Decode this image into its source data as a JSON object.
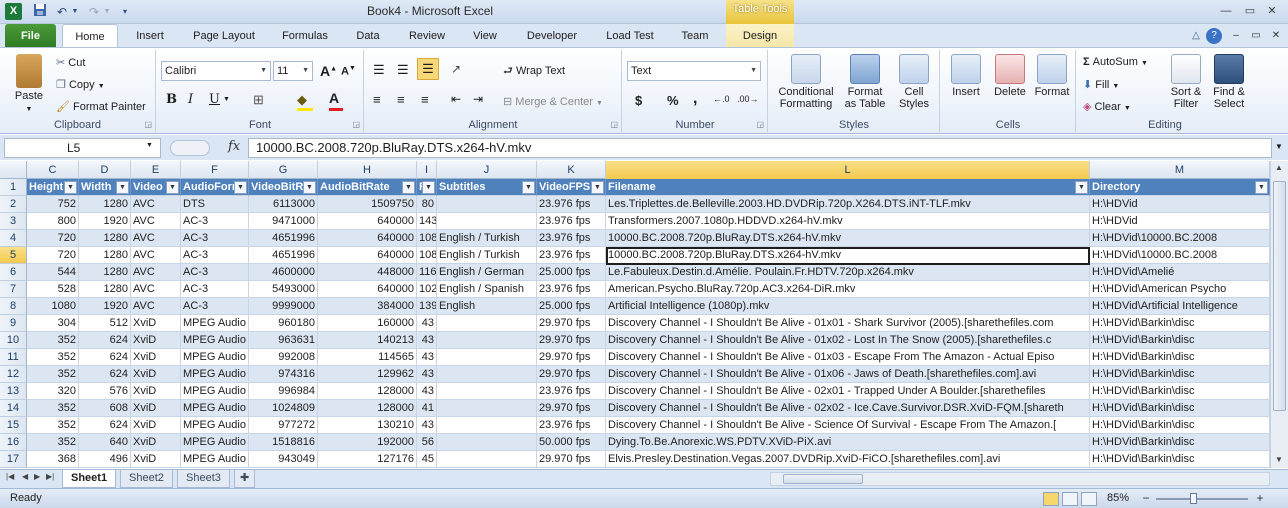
{
  "window": {
    "title": "Book4  -  Microsoft Excel",
    "contextual_tab": "Table Tools",
    "logo": "X",
    "qat_icons": [
      "save-icon",
      "undo-icon",
      "redo-icon",
      "customize-qat-icon"
    ],
    "controls": [
      "minimize-icon",
      "maximize-icon",
      "close-icon"
    ]
  },
  "tabs": [
    "File",
    "Home",
    "Insert",
    "Page Layout",
    "Formulas",
    "Data",
    "Review",
    "View",
    "Developer",
    "Load Test",
    "Team",
    "Design"
  ],
  "active_tab": "Home",
  "ribbon": {
    "clipboard": {
      "label": "Clipboard",
      "paste": "Paste",
      "cut": "Cut",
      "copy": "Copy",
      "format_painter": "Format Painter"
    },
    "font": {
      "label": "Font",
      "font_name": "Calibri",
      "font_size": "11",
      "bold": "B",
      "italic": "I",
      "underline": "U",
      "grow": "A",
      "shrink": "A"
    },
    "alignment": {
      "label": "Alignment",
      "wrap_text": "Wrap Text",
      "merge_center": "Merge & Center"
    },
    "number": {
      "label": "Number",
      "format": "Text",
      "currency": "$",
      "percent": "%",
      "comma": ","
    },
    "styles": {
      "label": "Styles",
      "conditional": [
        "Conditional",
        "Formatting"
      ],
      "format_table": [
        "Format",
        "as Table"
      ],
      "cell_styles": [
        "Cell",
        "Styles"
      ]
    },
    "cells": {
      "label": "Cells",
      "insert": "Insert",
      "delete": "Delete",
      "format": "Format"
    },
    "editing": {
      "label": "Editing",
      "autosum": "AutoSum",
      "fill": "Fill",
      "clear": "Clear",
      "sort_filter": [
        "Sort &",
        "Filter"
      ],
      "find_select": [
        "Find &",
        "Select"
      ]
    }
  },
  "formula_bar": {
    "name_box": "L5",
    "fx": "fx",
    "value": "10000.BC.2008.720p.BluRay.DTS.x264-hV.mkv"
  },
  "columns": [
    "C",
    "D",
    "E",
    "F",
    "G",
    "H",
    "I",
    "J",
    "K",
    "L",
    "M"
  ],
  "selected_column": "L",
  "header_row": {
    "row": "1",
    "cells": [
      "Height",
      "Width",
      "Video",
      "AudioForm",
      "VideoBitR",
      "AudioBitRate",
      "Ru",
      "Subtitles",
      "VideoFPS",
      "Filename",
      "Directory"
    ]
  },
  "rows": [
    {
      "row": "2",
      "cells": [
        "752",
        "1280",
        "AVC",
        "DTS",
        "6113000",
        "1509750",
        "80",
        "",
        "23.976 fps",
        "Les.Triplettes.de.Belleville.2003.HD.DVDRip.720p.X264.DTS.iNT-TLF.mkv",
        "H:\\HDVid"
      ]
    },
    {
      "row": "3",
      "cells": [
        "800",
        "1920",
        "AVC",
        "AC-3",
        "9471000",
        "640000",
        "143",
        "",
        "23.976 fps",
        "Transformers.2007.1080p.HDDVD.x264-hV.mkv",
        "H:\\HDVid"
      ]
    },
    {
      "row": "4",
      "cells": [
        "720",
        "1280",
        "AVC",
        "AC-3",
        "4651996",
        "640000",
        "108",
        "English / Turkish",
        "23.976 fps",
        "10000.BC.2008.720p.BluRay.DTS.x264-hV.mkv",
        "H:\\HDVid\\10000.BC.2008"
      ]
    },
    {
      "row": "5",
      "cells": [
        "720",
        "1280",
        "AVC",
        "AC-3",
        "4651996",
        "640000",
        "108",
        "English / Turkish",
        "23.976 fps",
        "10000.BC.2008.720p.BluRay.DTS.x264-hV.mkv",
        "H:\\HDVid\\10000.BC.2008"
      ]
    },
    {
      "row": "6",
      "cells": [
        "544",
        "1280",
        "AVC",
        "AC-3",
        "4600000",
        "448000",
        "116",
        "English / German",
        "25.000 fps",
        "Le.Fabuleux.Destin.d.Amélie. Poulain.Fr.HDTV.720p.x264.mkv",
        "H:\\HDVid\\Amelié"
      ]
    },
    {
      "row": "7",
      "cells": [
        "528",
        "1280",
        "AVC",
        "AC-3",
        "5493000",
        "640000",
        "102",
        "English / Spanish",
        "23.976 fps",
        "American.Psycho.BluRay.720p.AC3.x264-DiR.mkv",
        "H:\\HDVid\\American Psycho"
      ]
    },
    {
      "row": "8",
      "cells": [
        "1080",
        "1920",
        "AVC",
        "AC-3",
        "9999000",
        "384000",
        "139",
        "English",
        "25.000 fps",
        "Artificial Intelligence (1080p).mkv",
        "H:\\HDVid\\Artificial Intelligence"
      ]
    },
    {
      "row": "9",
      "cells": [
        "304",
        "512",
        "XviD",
        "MPEG Audio",
        "960180",
        "160000",
        "43",
        "",
        "29.970 fps",
        "Discovery Channel - I Shouldn't Be Alive - 01x01 - Shark Survivor (2005).[sharethefiles.com",
        "H:\\HDVid\\Barkin\\disc"
      ]
    },
    {
      "row": "10",
      "cells": [
        "352",
        "624",
        "XviD",
        "MPEG Audio",
        "963631",
        "140213",
        "43",
        "",
        "29.970 fps",
        "Discovery Channel - I Shouldn't Be Alive - 01x02 - Lost In The Snow (2005).[sharethefiles.c",
        "H:\\HDVid\\Barkin\\disc"
      ]
    },
    {
      "row": "11",
      "cells": [
        "352",
        "624",
        "XviD",
        "MPEG Audio",
        "992008",
        "114565",
        "43",
        "",
        "29.970 fps",
        "Discovery Channel - I Shouldn't Be Alive - 01x03 - Escape From The Amazon - Actual Episo",
        "H:\\HDVid\\Barkin\\disc"
      ]
    },
    {
      "row": "12",
      "cells": [
        "352",
        "624",
        "XviD",
        "MPEG Audio",
        "974316",
        "129962",
        "43",
        "",
        "29.970 fps",
        "Discovery Channel - I Shouldn't Be Alive - 01x06 - Jaws of Death.[sharethefiles.com].avi",
        "H:\\HDVid\\Barkin\\disc"
      ]
    },
    {
      "row": "13",
      "cells": [
        "320",
        "576",
        "XviD",
        "MPEG Audio",
        "996984",
        "128000",
        "43",
        "",
        "23.976 fps",
        "Discovery Channel - I Shouldn't Be Alive - 02x01 - Trapped Under A Boulder.[sharethefiles",
        "H:\\HDVid\\Barkin\\disc"
      ]
    },
    {
      "row": "14",
      "cells": [
        "352",
        "608",
        "XviD",
        "MPEG Audio",
        "1024809",
        "128000",
        "41",
        "",
        "29.970 fps",
        "Discovery Channel - I Shouldn't Be Alive - 02x02 - Ice.Cave.Survivor.DSR.XviD-FQM.[shareth",
        "H:\\HDVid\\Barkin\\disc"
      ]
    },
    {
      "row": "15",
      "cells": [
        "352",
        "624",
        "XviD",
        "MPEG Audio",
        "977272",
        "130210",
        "43",
        "",
        "23.976 fps",
        "Discovery Channel - I Shouldn't Be Alive - Science Of Survival - Escape From The Amazon.[",
        "H:\\HDVid\\Barkin\\disc"
      ]
    },
    {
      "row": "16",
      "cells": [
        "352",
        "640",
        "XviD",
        "MPEG Audio",
        "1518816",
        "192000",
        "56",
        "",
        "50.000 fps",
        "Dying.To.Be.Anorexic.WS.PDTV.XViD-PiX.avi",
        "H:\\HDVid\\Barkin\\disc"
      ]
    },
    {
      "row": "17",
      "cells": [
        "368",
        "496",
        "XviD",
        "MPEG Audio",
        "943049",
        "127176",
        "45",
        "",
        "29.970 fps",
        "Elvis.Presley.Destination.Vegas.2007.DVDRip.XviD-FiCO.[sharethefiles.com].avi",
        "H:\\HDVid\\Barkin\\disc"
      ]
    }
  ],
  "active_cell": "L5",
  "sheets": [
    "Sheet1",
    "Sheet2",
    "Sheet3"
  ],
  "active_sheet": "Sheet1",
  "status": {
    "ready": "Ready",
    "zoom": "85%",
    "minus": "−",
    "plus": "+"
  }
}
